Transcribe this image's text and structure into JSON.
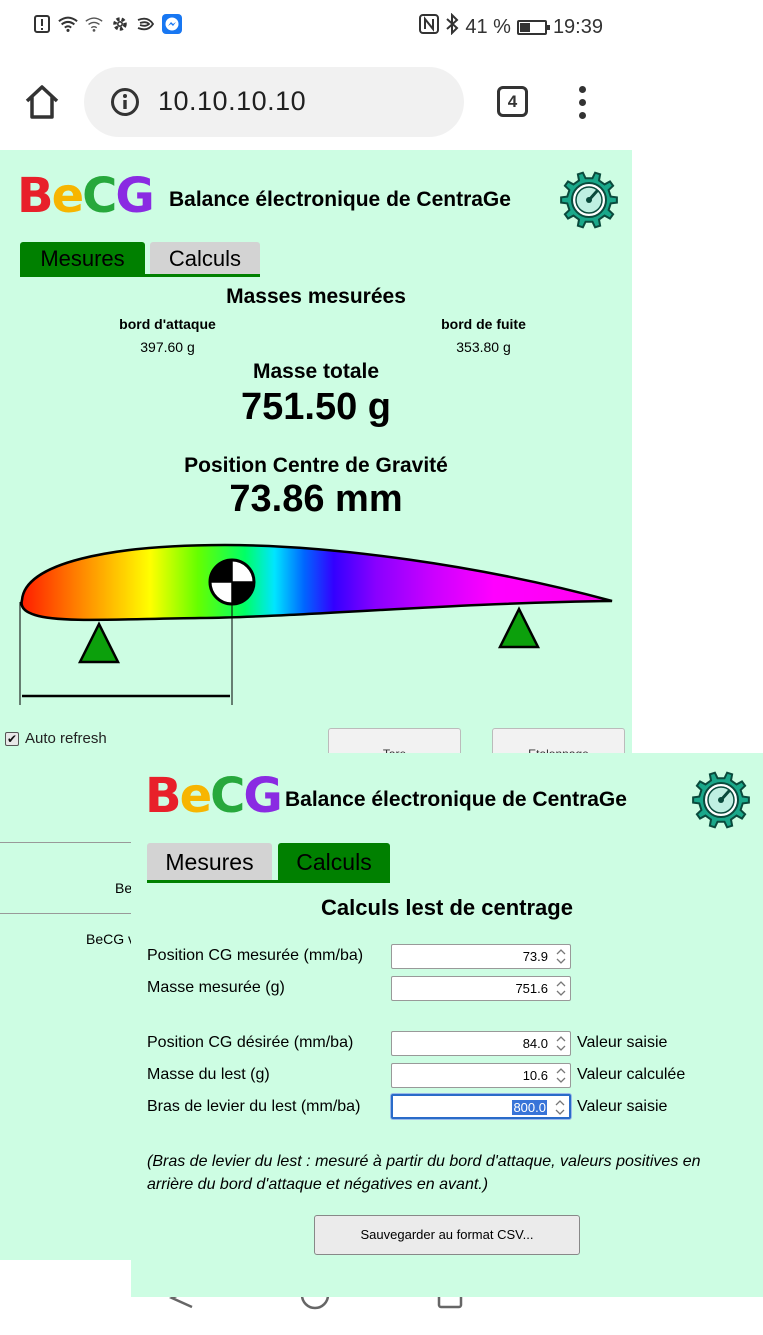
{
  "status_bar": {
    "battery_percent": "41 %",
    "battery_level": 0.41,
    "time": "19:39",
    "left_icons": [
      "alert-icon",
      "wifi-icon",
      "wifi-calling-icon",
      "settings-icon",
      "swipe-icon",
      "messenger-icon"
    ],
    "right_icons": [
      "nfc-icon",
      "bluetooth-icon",
      "battery-icon"
    ]
  },
  "browser": {
    "url": "10.10.10.10",
    "tab_count": "4"
  },
  "back_page": {
    "logo_letters": [
      "B",
      "e",
      "C",
      "G"
    ],
    "logo_colors": [
      "#e8202a",
      "#f7b500",
      "#27a83c",
      "#8a2be2"
    ],
    "app_title": "Balance électronique de CentraGe",
    "tabs": [
      {
        "label": "Mesures",
        "active": true
      },
      {
        "label": "Calculs",
        "active": false
      }
    ],
    "masses_heading": "Masses mesurées",
    "leading_edge_label": "bord d'attaque",
    "leading_edge_value": "397.60 g",
    "trailing_edge_label": "bord de fuite",
    "trailing_edge_value": "353.80 g",
    "total_label": "Masse totale",
    "total_value": "751.50 g",
    "cg_label": "Position Centre de Gravité",
    "cg_value": "73.86 mm",
    "cg_position_mm": 73.86,
    "auto_refresh_label": "Auto refresh",
    "auto_refresh_checked": true,
    "tare_button": "Tare",
    "calibration_button": "Etalonnage",
    "partial_text_1": "Be",
    "partial_text_2": "BeCG v"
  },
  "front_page": {
    "logo_letters": [
      "B",
      "e",
      "C",
      "G"
    ],
    "app_title": "Balance électronique de CentraGe",
    "tabs": [
      {
        "label": "Mesures",
        "active": false
      },
      {
        "label": "Calculs",
        "active": true
      }
    ],
    "heading": "Calculs lest de centrage",
    "fields": [
      {
        "label": "Position CG mesurée (mm/ba)",
        "value": "73.9",
        "note": ""
      },
      {
        "label": "Masse mesurée (g)",
        "value": "751.6",
        "note": ""
      },
      {
        "label": "Position CG désirée (mm/ba)",
        "value": "84.0",
        "note": "Valeur saisie"
      },
      {
        "label": "Masse du lest (g)",
        "value": "10.6",
        "note": "Valeur calculée"
      },
      {
        "label": "Bras de levier du lest (mm/ba)",
        "value": "800.0",
        "note": "Valeur saisie"
      }
    ],
    "note": "(Bras de levier du lest : mesuré à partir du bord d'attaque, valeurs positives en arrière du bord d'attaque et négatives en avant.)",
    "csv_button": "Sauvegarder au format CSV..."
  },
  "accent_colors": {
    "page_bg": "#cdfde3",
    "tab_active": "#008000",
    "tab_inactive": "#d3d3d3",
    "gear": "#1aa88a"
  }
}
